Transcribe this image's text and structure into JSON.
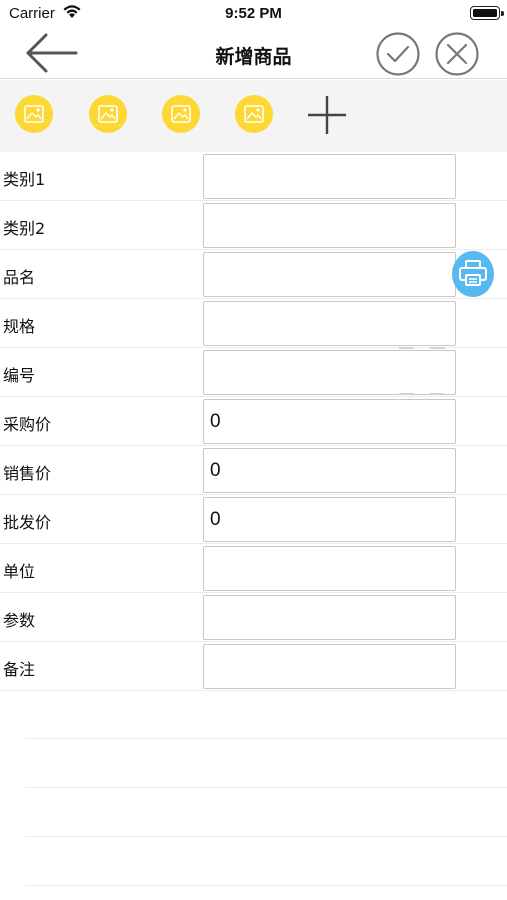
{
  "status_bar": {
    "carrier": "Carrier",
    "time": "9:52 PM",
    "wifi_icon": "wifi-icon",
    "battery_icon": "battery-icon"
  },
  "nav": {
    "title": "新增商品",
    "back_icon": "arrow-left-icon",
    "confirm_icon": "check-circle-icon",
    "cancel_icon": "close-circle-icon"
  },
  "photos": {
    "slot_icon": "image-icon",
    "slot_color": "#fdd835",
    "slot_count": 4,
    "add_icon": "plus-icon"
  },
  "form": {
    "fields": [
      {
        "label": "类别1",
        "value": ""
      },
      {
        "label": "类别2",
        "value": ""
      },
      {
        "label": "品名",
        "value": ""
      },
      {
        "label": "规格",
        "value": ""
      },
      {
        "label": "编号",
        "value": ""
      },
      {
        "label": "采购价",
        "value": "0"
      },
      {
        "label": "销售价",
        "value": "0"
      },
      {
        "label": "批发价",
        "value": "0"
      },
      {
        "label": "单位",
        "value": ""
      },
      {
        "label": "参数",
        "value": ""
      },
      {
        "label": "备注",
        "value": ""
      }
    ]
  },
  "floating": {
    "print_icon": "printer-icon",
    "print_color": "#5ab8f0"
  }
}
